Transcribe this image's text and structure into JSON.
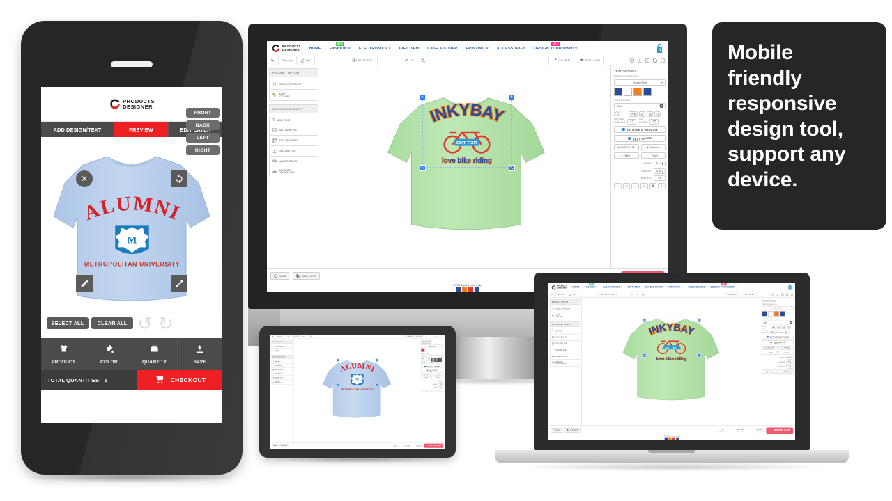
{
  "promo": {
    "headline": "Mobile friendly responsive design tool, support any device."
  },
  "brand": {
    "line1": "PRODUCTS",
    "line2": "DESIGNER",
    "mark_color": "#e3262c"
  },
  "colors": {
    "accent_red": "#ee2024",
    "nav_link": "#1f5fa8",
    "cart_blue": "#2e9bd6",
    "badge_new": "#44c24a",
    "badge_hot": "#ff2e86",
    "add_to_cart": "#f4566b",
    "shirt_green": "#b6e2a6",
    "shirt_blue": "#b6cdeb"
  },
  "phone": {
    "tabs": [
      {
        "label": "ADD DESIGN/TEXT",
        "active": false
      },
      {
        "label": "PREVIEW",
        "active": true
      },
      {
        "label": "EDIT LAYER",
        "active": false
      }
    ],
    "canvas_handles": [
      "close-icon",
      "rotate-icon",
      "edit-icon",
      "resize-icon"
    ],
    "buttons": [
      {
        "label": "SELECT ALL"
      },
      {
        "label": "CLEAR ALL"
      }
    ],
    "side_views": [
      "FRONT",
      "BACK",
      "LEFT",
      "RIGHT"
    ],
    "icon_bar": [
      {
        "label": "PRODUCT",
        "icon": "tshirt-icon"
      },
      {
        "label": "COLOR",
        "icon": "paint-bucket-icon"
      },
      {
        "label": "QUANTITY",
        "icon": "quantity-icon"
      },
      {
        "label": "SAVE",
        "icon": "save-icon"
      }
    ],
    "footer": {
      "total_label": "TOTAL QUANTITIES:",
      "total_value": "1",
      "checkout_label": "CHECKOUT",
      "checkout_icon": "cart-icon"
    },
    "design": {
      "top_text": "ALUMNI",
      "monogram": "M",
      "bottom_text": "METROPOLITAN UNIVERSITY"
    }
  },
  "app": {
    "nav": [
      {
        "label": "HOME",
        "caret": false,
        "badge": ""
      },
      {
        "label": "FASHION",
        "caret": true,
        "badge": "NEW",
        "badge_type": "new"
      },
      {
        "label": "ELECTRONICS",
        "caret": true,
        "badge": ""
      },
      {
        "label": "GIFT ITEM",
        "caret": false,
        "badge": ""
      },
      {
        "label": "CASE & COVER",
        "caret": false,
        "badge": ""
      },
      {
        "label": "PRINTING",
        "caret": true,
        "badge": ""
      },
      {
        "label": "ACCESSORIES",
        "caret": false,
        "badge": ""
      },
      {
        "label": "DESIGN YOUR OWN!",
        "caret": true,
        "badge": "HOT!",
        "badge_type": "hot"
      }
    ],
    "cart_count": "0",
    "toolbar": [
      {
        "label": "",
        "icon": "pointer-icon"
      },
      {
        "label": "Size :ync",
        "icon": ""
      },
      {
        "label": "Inch",
        "icon": "ruler-icon"
      },
      {
        "label": "",
        "icon": ""
      },
      {
        "label": "SELECT ALL",
        "icon": "eye-icon"
      },
      {
        "label": "",
        "icon": "undo-icon"
      },
      {
        "label": "",
        "icon": "redo-icon"
      },
      {
        "label": "",
        "icon": "zoom-icon"
      },
      {
        "label": "CLEAR ALL",
        "icon": "refresh-icon"
      },
      {
        "label": "EDIT LAYER",
        "icon": "layers-icon"
      },
      {
        "label": "",
        "icon": "help-icon"
      },
      {
        "label": "",
        "icon": "download-icon"
      },
      {
        "label": "",
        "icon": "share-icon"
      },
      {
        "label": "",
        "icon": "save-icon"
      },
      {
        "label": "",
        "icon": "fullscreen-icon"
      }
    ],
    "left_panel": {
      "group1_title": "PRODUCT OPTION",
      "group1_items": [
        {
          "label": "SELECT PRODUCT",
          "icon": "tshirt-icon"
        },
        {
          "label": "EDIT COLOR",
          "icon": "palette-icon"
        }
      ],
      "group2_title": "ADD DESIGN OBJECT",
      "group2_items": [
        {
          "label": "ADD TEXT",
          "icon": "text-icon"
        },
        {
          "label": "ADD GRAPHIC",
          "icon": "image-icon"
        },
        {
          "label": "ADD QR CODE",
          "icon": "qr-icon"
        },
        {
          "label": "UPLOAD FILE",
          "icon": "upload-icon"
        },
        {
          "label": "NAMES OR #S",
          "icon": "numbers-icon"
        },
        {
          "label": "BROWSE DESIGN IDEA",
          "icon": "browse-icon"
        }
      ]
    },
    "right_panel": {
      "title": "TEXT OPTIONS",
      "printing_method_label": "PRINTING METHOD:",
      "printing_method_value": "Screen Print",
      "swatches": [
        "#2a4a9a",
        "#ffffff",
        "#f07f1a",
        "#2a4a9a"
      ],
      "select_font_label": "SELECT FONT",
      "font_value": "Aero",
      "font_size_label": "FONT SIZE",
      "font_size_value": "28",
      "letter_spacing_label": "LETTER SPACING",
      "letter_spacing_value": "0",
      "line_height_label": "LINE HEIGHT",
      "line_height_value": "0",
      "outline_shadow_label": "OUTLINE & SHADOW",
      "text_shape_label": "TEXT SHAPE",
      "duplicate_label": "DUPLICATE",
      "remove_label": "Remove",
      "flip_h_label": "Flip H",
      "flip_v_label": "Flip V",
      "width_label": "WIDTH",
      "width_value": "9.17",
      "height_label": "HEIGHT",
      "height_value": "3.59",
      "rotate_label": "ROTATE",
      "rotate_value": "0",
      "align_icons": [
        "align-left-icon",
        "align-center-icon",
        "align-right-icon",
        "align-bottom-icon",
        "align-middle-icon",
        "align-top-icon"
      ]
    },
    "bottom": {
      "save_label": "SAVE",
      "add_note_label": "ADD NOTE",
      "quantity_value": "1",
      "quantity_label": "QUANTITY",
      "unit_price_value": "$17.56",
      "unit_price_label": "UNIT PRICE",
      "total_price_value": "$17.56",
      "total_price_label": "TOTAL PRICE",
      "add_to_cart_label": "Add to Cart",
      "print_colors_label": "FRONT print colors (4):",
      "print_colors": [
        "#2a4a9a",
        "#f07f1a",
        "#e03a2f",
        "#2a4a9a"
      ]
    },
    "design_green": {
      "top_text": "INKYBAY",
      "badge_text": "EDIT TEXT",
      "bottom_text": "love bike riding",
      "graphic": "bicycle-icon"
    }
  }
}
